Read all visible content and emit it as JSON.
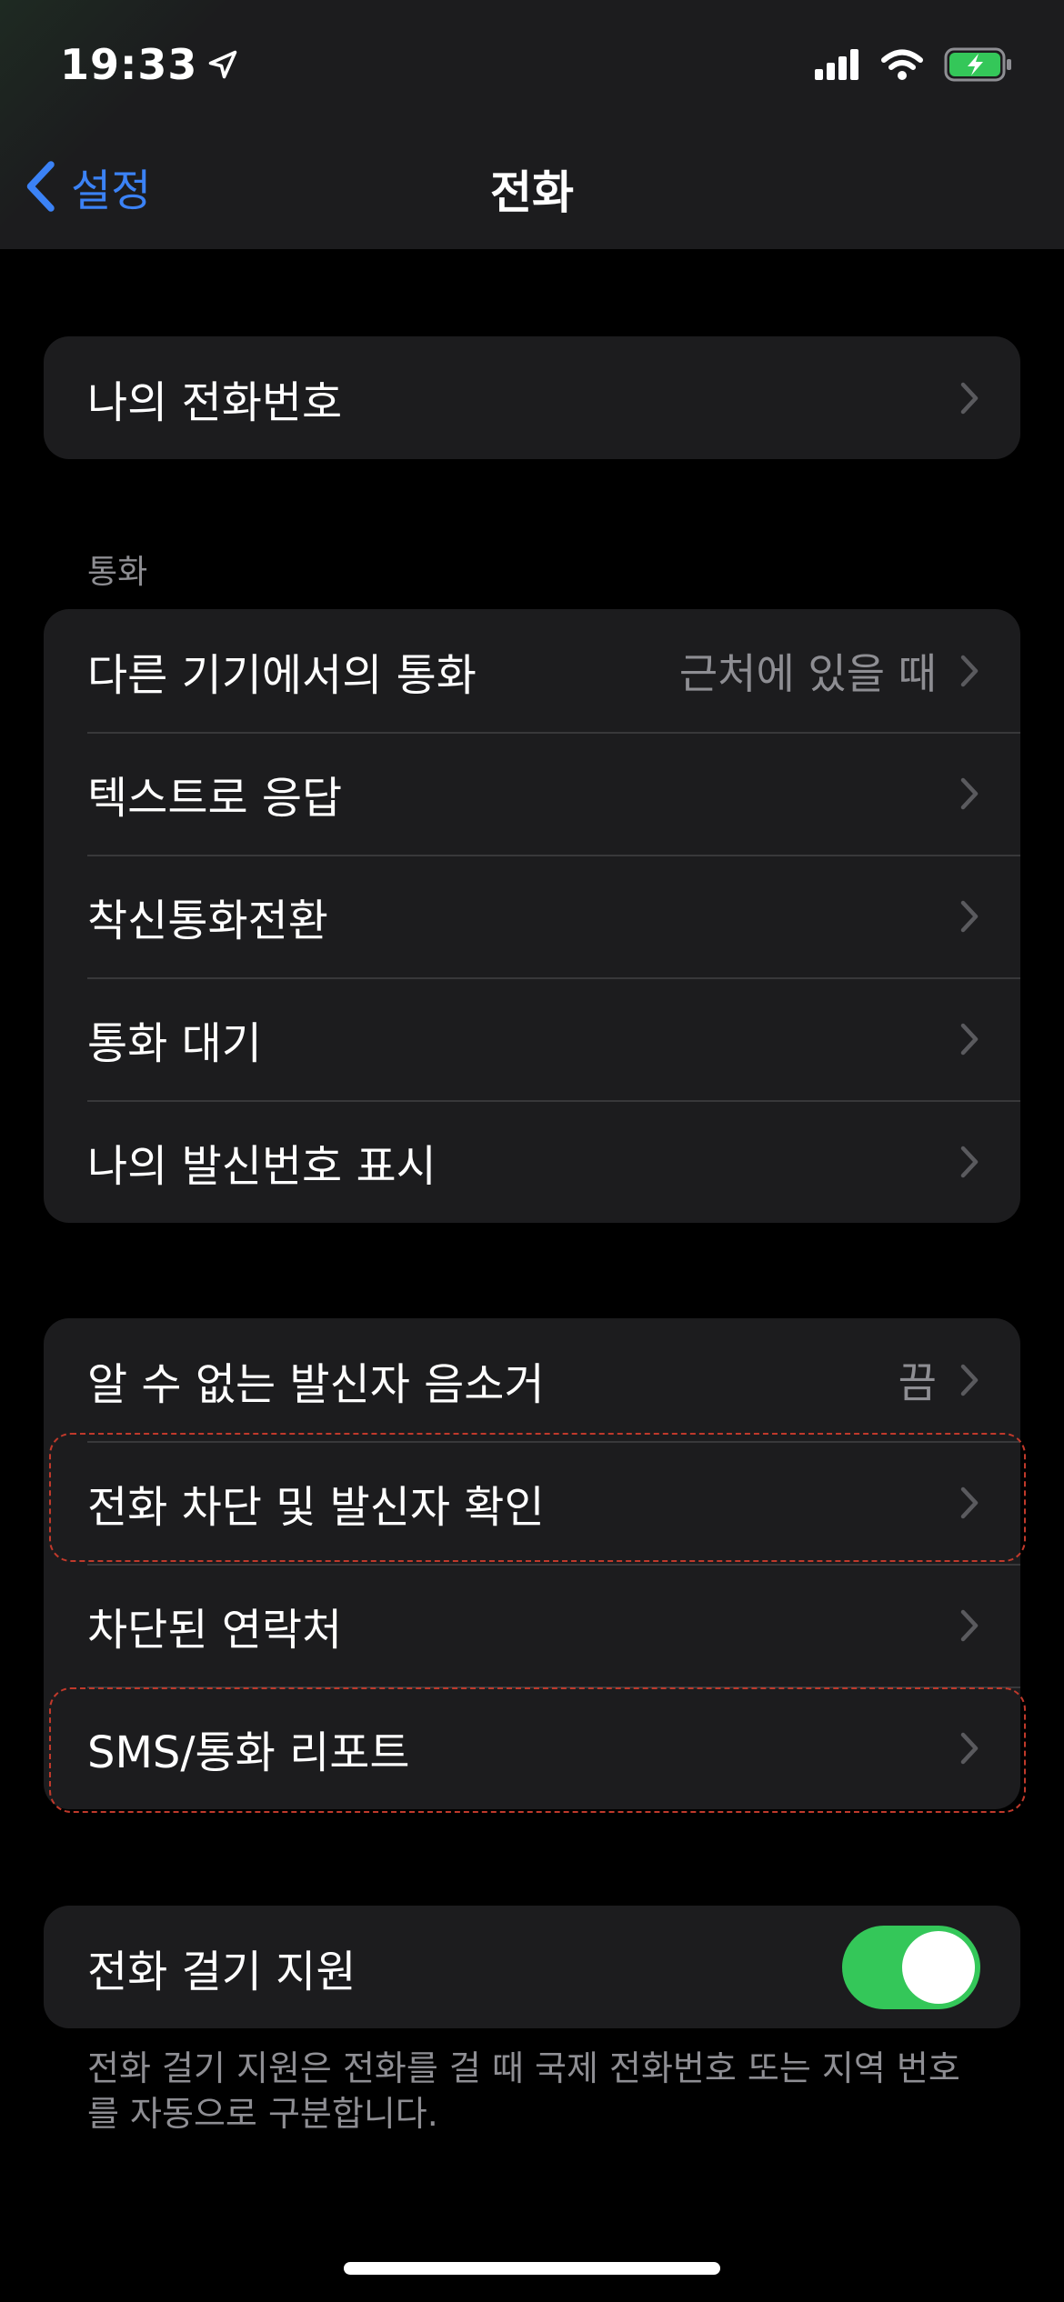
{
  "status_bar": {
    "time": "19:33",
    "icons": [
      "location-arrow-icon",
      "cellular-signal-icon",
      "wifi-icon",
      "battery-charging-icon"
    ]
  },
  "nav": {
    "back_label": "설정",
    "title": "전화"
  },
  "group1": {
    "my_number_label": "나의 전화번호"
  },
  "calls_section": {
    "header": "통화",
    "rows": [
      {
        "label": "다른 기기에서의 통화",
        "value": "근처에 있을 때"
      },
      {
        "label": "텍스트로 응답",
        "value": ""
      },
      {
        "label": "착신통화전환",
        "value": ""
      },
      {
        "label": "통화 대기",
        "value": ""
      },
      {
        "label": "나의 발신번호 표시",
        "value": ""
      }
    ]
  },
  "blocking_section": {
    "rows": [
      {
        "label": "알 수 없는 발신자 음소거",
        "value": "끔"
      },
      {
        "label": "전화 차단 및 발신자 확인",
        "value": ""
      },
      {
        "label": "차단된 연락처",
        "value": ""
      },
      {
        "label": "SMS/통화 리포트",
        "value": ""
      }
    ]
  },
  "dial_assist": {
    "label": "전화 걸기 지원",
    "enabled": true,
    "footnote": "전화 걸기 지원은 전화를 걸 때 국제 전화번호 또는 지역 번호를 자동으로 구분합니다."
  },
  "colors": {
    "accent": "#3b82f6",
    "toggle_on": "#34c759",
    "cell_bg": "#1c1c1e",
    "highlight": "#c0392b"
  }
}
